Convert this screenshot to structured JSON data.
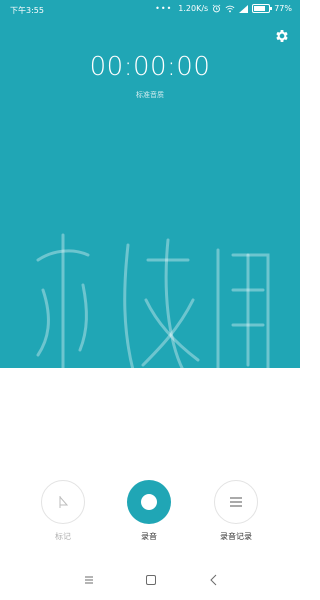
{
  "status_bar": {
    "time": "下午3:55",
    "dots": "•••",
    "speed": "1.20K/s",
    "battery": "77%",
    "battery_level": 0.77,
    "icons": [
      "alarm-icon",
      "wifi-icon",
      "signal-icon",
      "battery-icon"
    ]
  },
  "header": {
    "settings_icon": "gear-icon"
  },
  "timer": {
    "value": "00:00:00",
    "quality": "标准音质"
  },
  "watermark": {
    "text": "游侠网"
  },
  "controls": {
    "mark_label": "标记",
    "record_label": "录音",
    "records_label": "录音记录",
    "mark_icon": "flag-icon",
    "record_icon": "record-icon",
    "records_icon": "list-icon"
  },
  "nav_bar": {
    "icons": [
      "menu-icon",
      "home-icon",
      "back-icon"
    ]
  },
  "colors": {
    "accent": "#20a6b5",
    "background": "#ffffff"
  }
}
